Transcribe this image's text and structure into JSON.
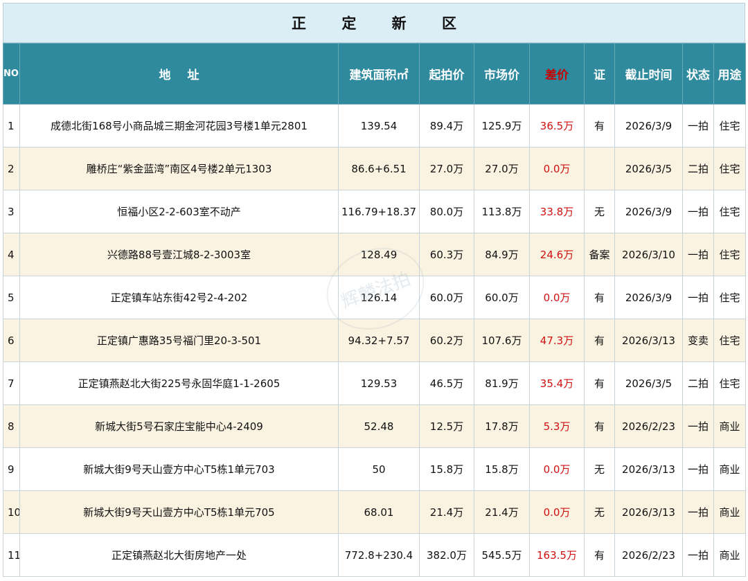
{
  "title": "正 定 新 区",
  "headers": {
    "no": "NO.",
    "address": "地址",
    "area": "建筑面积㎡",
    "start_price": "起拍价",
    "market_price": "市场价",
    "diff": "差价",
    "cert": "证",
    "deadline": "截止时间",
    "status": "状态",
    "usage": "用途"
  },
  "watermark": "辉麟法拍",
  "rows": [
    {
      "no": "1",
      "address": "成德北街168号小商品城三期金河花园3号楼1单元2801",
      "area": "139.54",
      "start": "89.4万",
      "market": "125.9万",
      "diff": "36.5万",
      "cert": "有",
      "deadline": "2026/3/9",
      "status": "一拍",
      "usage": "住宅"
    },
    {
      "no": "2",
      "address": "雕桥庄“紫金蓝湾”南区4号楼2单元1303",
      "area": "86.6+6.51",
      "start": "27.0万",
      "market": "27.0万",
      "diff": "0.0万",
      "cert": "",
      "deadline": "2026/3/5",
      "status": "二拍",
      "usage": "住宅"
    },
    {
      "no": "3",
      "address": "恒福小区2-2-603室不动产",
      "area": "116.79+18.37",
      "start": "80.0万",
      "market": "113.8万",
      "diff": "33.8万",
      "cert": "无",
      "deadline": "2026/3/9",
      "status": "一拍",
      "usage": "住宅"
    },
    {
      "no": "4",
      "address": "兴德路88号壹江城8-2-3003室",
      "area": "128.49",
      "start": "60.3万",
      "market": "84.9万",
      "diff": "24.6万",
      "cert": "备案",
      "deadline": "2026/3/10",
      "status": "一拍",
      "usage": "住宅"
    },
    {
      "no": "5",
      "address": "正定镇车站东街42号2-4-202",
      "area": "126.14",
      "start": "60.0万",
      "market": "60.0万",
      "diff": "0.0万",
      "cert": "有",
      "deadline": "2026/3/9",
      "status": "一拍",
      "usage": "住宅"
    },
    {
      "no": "6",
      "address": "正定镇广惠路35号福门里20-3-501",
      "area": "94.32+7.57",
      "start": "60.2万",
      "market": "107.6万",
      "diff": "47.3万",
      "cert": "有",
      "deadline": "2026/3/13",
      "status": "变卖",
      "usage": "住宅"
    },
    {
      "no": "7",
      "address": "正定镇燕赵北大街225号永固华庭1-1-2605",
      "area": "129.53",
      "start": "46.5万",
      "market": "81.9万",
      "diff": "35.4万",
      "cert": "有",
      "deadline": "2026/3/5",
      "status": "二拍",
      "usage": "住宅"
    },
    {
      "no": "8",
      "address": "新城大街5号石家庄宝能中心4-2409",
      "area": "52.48",
      "start": "12.5万",
      "market": "17.8万",
      "diff": "5.3万",
      "cert": "有",
      "deadline": "2026/2/23",
      "status": "一拍",
      "usage": "商业"
    },
    {
      "no": "9",
      "address": "新城大街9号天山壹方中心T5栋1单元703",
      "area": "50",
      "start": "15.8万",
      "market": "15.8万",
      "diff": "0.0万",
      "cert": "无",
      "deadline": "2026/3/13",
      "status": "一拍",
      "usage": "商业"
    },
    {
      "no": "10",
      "address": "新城大街9号天山壹方中心T5栋1单元705",
      "area": "68.01",
      "start": "21.4万",
      "market": "21.4万",
      "diff": "0.0万",
      "cert": "无",
      "deadline": "2026/3/13",
      "status": "一拍",
      "usage": "商业"
    },
    {
      "no": "11",
      "address": "正定镇燕赵北大街房地产一处",
      "area": "772.8+230.4",
      "start": "382.0万",
      "market": "545.5万",
      "diff": "163.5万",
      "cert": "有",
      "deadline": "2026/2/23",
      "status": "一拍",
      "usage": "商业"
    }
  ]
}
